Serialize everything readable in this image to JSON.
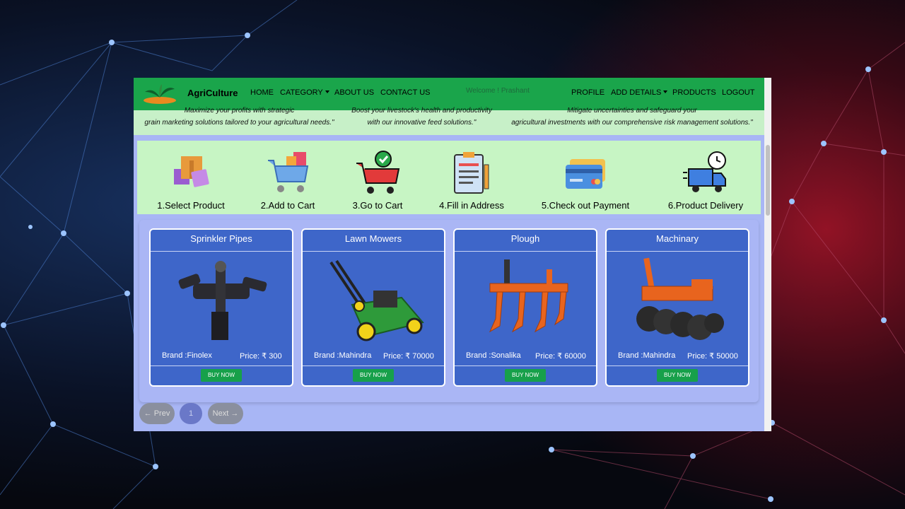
{
  "navbar": {
    "brand": "AgriCulture",
    "links": [
      "HOME",
      "CATEGORY",
      "ABOUT US",
      "CONTACT US"
    ],
    "welcome": "Welcome ! Prashant",
    "right_links": [
      "PROFILE",
      "ADD DETAILS",
      "PRODUCTS",
      "LOGOUT"
    ]
  },
  "quotes": [
    {
      "line1": "Maximize your profits with strategic",
      "line2": "grain marketing solutions tailored to your agricultural needs.\""
    },
    {
      "line1": "Boost your livestock's health and productivity",
      "line2": "with our innovative feed solutions.\""
    },
    {
      "line1": "Mitigate uncertainties and safeguard your",
      "line2": "agricultural investments with our comprehensive risk management solutions.\""
    }
  ],
  "steps": [
    {
      "label": "1.Select Product",
      "icon": "boxes-icon"
    },
    {
      "label": "2.Add to Cart",
      "icon": "cart-add-icon"
    },
    {
      "label": "3.Go to Cart",
      "icon": "cart-check-icon"
    },
    {
      "label": "4.Fill in Address",
      "icon": "clipboard-icon"
    },
    {
      "label": "5.Check out Payment",
      "icon": "credit-card-icon"
    },
    {
      "label": "6.Product Delivery",
      "icon": "delivery-truck-icon"
    }
  ],
  "products": [
    {
      "title": "Sprinkler Pipes",
      "brand": "Brand :Finolex",
      "price": "Price: ₹ 300",
      "button": "BUY NOW",
      "icon": "sprinkler-icon"
    },
    {
      "title": "Lawn Mowers",
      "brand": "Brand :Mahindra",
      "price": "Price: ₹ 70000",
      "button": "BUY NOW",
      "icon": "lawn-mower-icon"
    },
    {
      "title": "Plough",
      "brand": "Brand :Sonalika",
      "price": "Price: ₹ 60000",
      "button": "BUY NOW",
      "icon": "plough-icon"
    },
    {
      "title": "Machinary",
      "brand": "Brand :Mahindra",
      "price": "Price: ₹ 50000",
      "button": "BUY NOW",
      "icon": "disc-harrow-icon"
    }
  ],
  "pagination": {
    "prev": "← Prev",
    "page": "1",
    "next": "Next →"
  },
  "colors": {
    "navbar": "#1aa54b",
    "card": "#3e66c9",
    "steps_bg": "#c7f5c4",
    "content_bg": "#a8b6f5",
    "buy_button": "#17a04a"
  }
}
